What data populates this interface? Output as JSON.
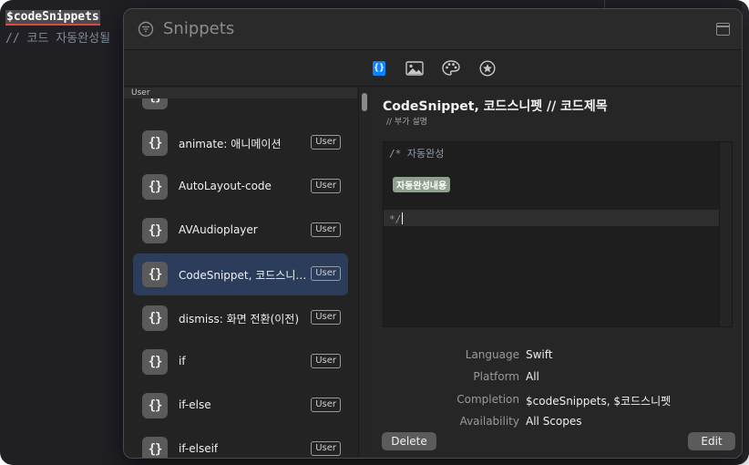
{
  "editor": {
    "line1": "$codeSnippets",
    "line2": "// 코드 자동완성될"
  },
  "window": {
    "title": "Snippets"
  },
  "toolbar": {
    "tabs": [
      {
        "name": "code-snippets",
        "icon": "braces-icon",
        "active": true
      },
      {
        "name": "media",
        "icon": "image-icon",
        "active": false
      },
      {
        "name": "colors",
        "icon": "palette-icon",
        "active": false
      },
      {
        "name": "symbols",
        "icon": "star-icon",
        "active": false
      }
    ],
    "active_label": "{}"
  },
  "sidebar": {
    "section_header": "User",
    "icon_glyph": "{}",
    "items": [
      {
        "label": "animate: 애니메이션",
        "badge": "User",
        "selected": false
      },
      {
        "label": "AutoLayout-code",
        "badge": "User",
        "selected": false
      },
      {
        "label": "AVAudioplayer",
        "badge": "User",
        "selected": false
      },
      {
        "label": "CodeSnippet, 코드스니펫 // 코드제목",
        "badge": "User",
        "selected": true
      },
      {
        "label": "dismiss: 화면 전환(이전)",
        "badge": "User",
        "selected": false
      },
      {
        "label": "if",
        "badge": "User",
        "selected": false
      },
      {
        "label": "if-else",
        "badge": "User",
        "selected": false
      },
      {
        "label": "if-elseif",
        "badge": "User",
        "selected": false
      }
    ]
  },
  "detail": {
    "title": "CodeSnippet, 코드스니펫 // 코드제목",
    "summary": "// 부가 설명",
    "code": {
      "line1": "/* 자동완성",
      "placeholder": "자동완성내용",
      "line3": "*/"
    },
    "properties": {
      "language_label": "Language",
      "language_value": "Swift",
      "platform_label": "Platform",
      "platform_value": "All",
      "completion_label": "Completion",
      "completion_value": "$codeSnippets, $코드스니펫",
      "availability_label": "Availability",
      "availability_value": "All Scopes"
    },
    "delete_label": "Delete",
    "edit_label": "Edit"
  },
  "colors": {
    "accent": "#0a84ff",
    "selection": "#2c3d5c",
    "placeholder_token": "#8fa08f"
  }
}
